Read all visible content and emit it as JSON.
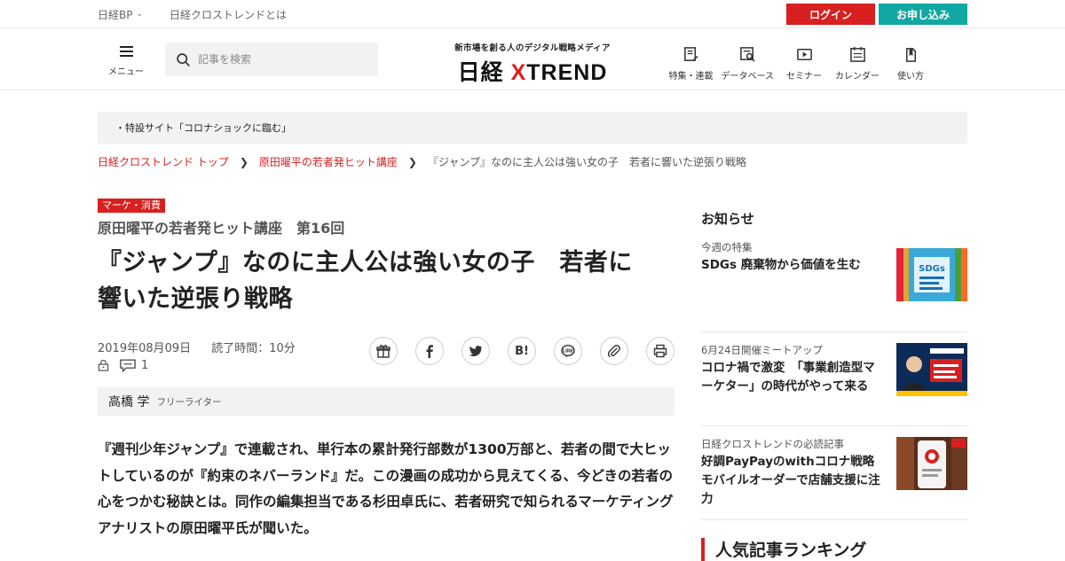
{
  "util": {
    "brand_link": "日経BP",
    "about_link": "日経クロストレンドとは",
    "login": "ログイン",
    "signup": "お申し込み"
  },
  "header": {
    "menu_label": "メニュー",
    "search_placeholder": "記事を検索",
    "tagline": "新市場を創る人のデジタル戦略メディア",
    "logo_prefix": "日経",
    "logo_x": "X",
    "logo_suffix": "TREND",
    "nav": [
      {
        "label": "特集・連載",
        "icon": "feature-icon"
      },
      {
        "label": "データベース",
        "icon": "database-icon"
      },
      {
        "label": "セミナー",
        "icon": "seminar-icon"
      },
      {
        "label": "カレンダー",
        "icon": "calendar-icon"
      },
      {
        "label": "使い方",
        "icon": "guide-icon"
      }
    ]
  },
  "banner": "・特設サイト「コロナショックに臨む」",
  "breadcrumb": {
    "items": [
      "日経クロストレンド トップ",
      "原田曜平の若者発ヒット講座"
    ],
    "current": "『ジャンプ』なのに主人公は強い女の子　若者に響いた逆張り戦略"
  },
  "article": {
    "category": "マーケ・消費",
    "series": "原田曜平の若者発ヒット講座　第16回",
    "title_line1": "『ジャンプ』なのに主人公は強い女の子　若者に",
    "title_line2": "響いた逆張り戦略",
    "date": "2019年08月09日",
    "read_time": "読了時間：10分",
    "comment_count": "1",
    "author_name": "高橋 学",
    "author_role": "フリーライター",
    "lead": "『週刊少年ジャンプ』で連載され、単行本の累計発行部数が1300万部と、若者の間で大ヒットしているのが『約束のネバーランド』だ。この漫画の成功から見えてくる、今どきの若者の心をつかむ秘訣とは。同作の編集担当である杉田卓氏に、若者研究で知られるマーケティングアナリストの原田曜平氏が聞いた。",
    "share_icons": [
      "gift-icon",
      "facebook-icon",
      "twitter-icon",
      "hatena-bookmark-icon",
      "line-icon",
      "link-icon",
      "print-icon"
    ],
    "share_hatena_text": "B!"
  },
  "sidebar": {
    "notice_heading": "お知らせ",
    "items": [
      {
        "kicker": "今週の特集",
        "title": "SDGs 廃棄物から価値を生む",
        "thumb_text": "SDGs"
      },
      {
        "kicker": "6月24日開催ミートアップ",
        "title": "コロナ禍で激変　「事業創造型マーケター」の時代がやって来る",
        "thumb_text": ""
      },
      {
        "kicker": "日経クロストレンドの必読記事",
        "title": "好調PayPayのwithコロナ戦略　モバイルオーダーで店舗支援に注力",
        "thumb_text": ""
      }
    ],
    "ranking_heading": "人気記事ランキング"
  },
  "colors": {
    "accent": "#d7201f",
    "teal": "#11a8a4",
    "panel": "#f2f2f2"
  }
}
